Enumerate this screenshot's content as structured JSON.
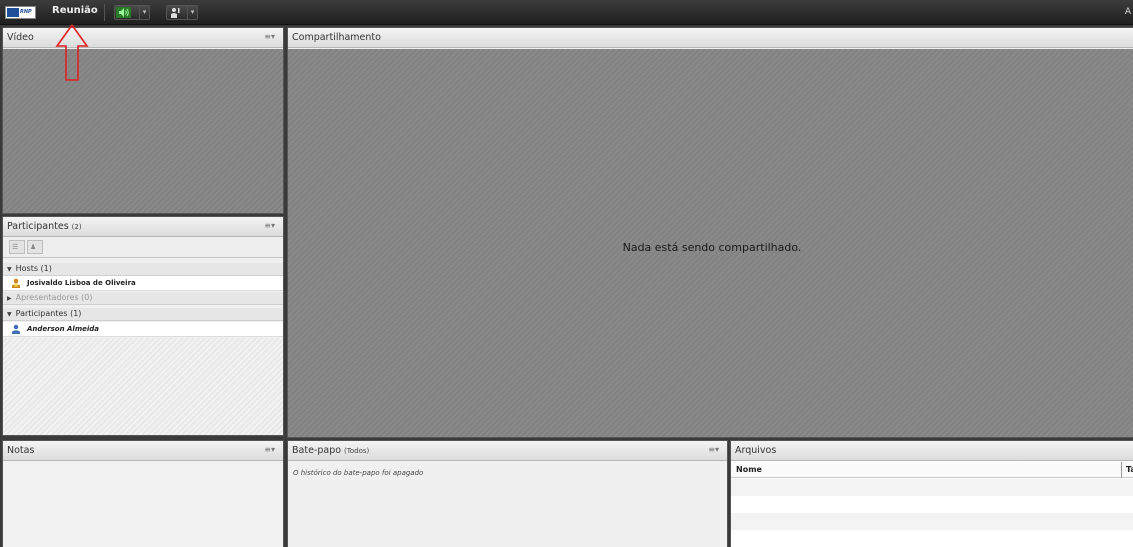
{
  "topbar": {
    "logo_text": "RNP",
    "menu_label": "Reunião",
    "right_label": "A",
    "speaker_icon": "speaker-icon",
    "user_status_icon": "raise-hand-icon",
    "speaker_color": "#33cc33"
  },
  "video_pod": {
    "title": "Vídeo"
  },
  "share_pod": {
    "title": "Compartilhamento",
    "message": "Nada está sendo compartilhado."
  },
  "participants_pod": {
    "title": "Participantes",
    "count": "(2)",
    "groups": [
      {
        "label": "Hosts (1)",
        "expanded": true
      },
      {
        "label": "Apresentadores (0)",
        "expanded": false
      },
      {
        "label": "Participantes (1)",
        "expanded": true
      }
    ],
    "hosts": [
      {
        "name": "Josivaldo Lisboa de Oliveira"
      }
    ],
    "participants": [
      {
        "name": "Anderson Almeida"
      }
    ]
  },
  "notes_pod": {
    "title": "Notas"
  },
  "chat_pod": {
    "title": "Bate-papo",
    "subtitle": "(Todos)",
    "message": "O histórico do bate-papo foi apagado"
  },
  "files_pod": {
    "title": "Arquivos",
    "columns": [
      "Nome",
      "Ta"
    ]
  },
  "colors": {
    "annotation_arrow": "#e02020",
    "pod_hatch": "#8a8a8a"
  }
}
